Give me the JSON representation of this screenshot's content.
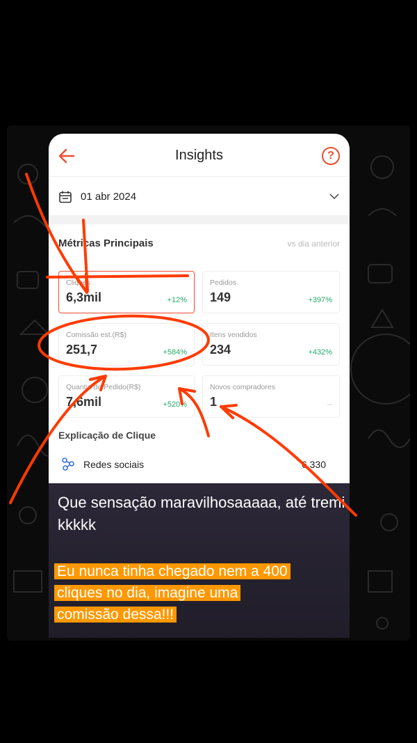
{
  "header": {
    "title": "Insights",
    "help_label": "?"
  },
  "date_selector": {
    "value": "01 abr 2024"
  },
  "metrics": {
    "title": "Métricas Principais",
    "comparison": "vs dia anterior",
    "cards": [
      {
        "label": "Cliques",
        "value": "6,3mil",
        "change": "+12%"
      },
      {
        "label": "Pedidos",
        "value": "149",
        "change": "+397%"
      },
      {
        "label": "Comissão est.(R$)",
        "value": "251,7",
        "change": "+584%"
      },
      {
        "label": "Itens vendidos",
        "value": "234",
        "change": "+432%"
      },
      {
        "label": "Quantia do Pedido(R$)",
        "value": "7,6mil",
        "change": "+520%"
      },
      {
        "label": "Novos compradores",
        "value": "1",
        "change": "--"
      }
    ]
  },
  "click_explanation": {
    "title": "Explicação de Clique",
    "rows": [
      {
        "label": "Redes sociais",
        "value": "6.330"
      }
    ]
  },
  "captions": {
    "line1": "Que sensação maravilhosaaaaa, até tremi kkkkk",
    "line2": "Eu nunca tinha chegado nem a 400",
    "line3": "cliques no dia, imagine uma",
    "line4": "comissão dessa!!!"
  },
  "colors": {
    "accent": "#ee4d2d",
    "positive": "#26aa6b",
    "annotation": "#ff3b00",
    "highlight": "#ff9800"
  }
}
